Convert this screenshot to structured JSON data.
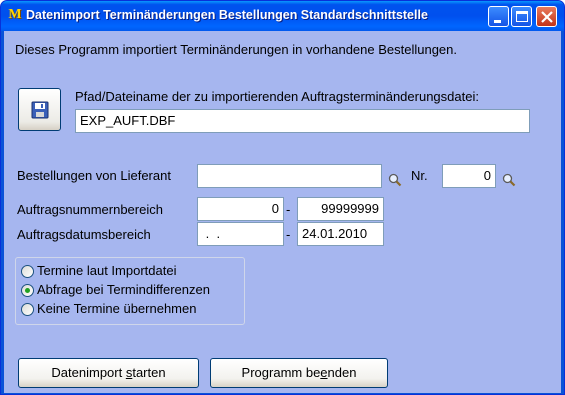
{
  "window": {
    "app_icon": "M",
    "title": "Datenimport Terminänderungen Bestellungen Standardschnittstelle"
  },
  "intro_text": "Dieses Programm importiert Terminänderungen in vorhandene Bestellungen.",
  "file": {
    "label": "Pfad/Dateiname der zu importierenden Auftragsterminänderungsdatei:",
    "value": "EXP_AUFT.DBF",
    "button_icon": "floppy-disk-icon"
  },
  "supplier": {
    "label": "Bestellungen von Lieferant",
    "value": "",
    "nr_label": "Nr.",
    "nr_value": "0",
    "search_icon": "magnifier-icon"
  },
  "order_range": {
    "label": "Auftragsnummernbereich",
    "from": "0",
    "separator": "-",
    "to": "99999999"
  },
  "date_range": {
    "label": "Auftragsdatumsbereich",
    "from": " .  .",
    "separator": "-",
    "to": "24.01.2010"
  },
  "options": [
    {
      "label": "Termine laut Importdatei",
      "selected": false
    },
    {
      "label": "Abfrage bei Termindifferenzen",
      "selected": true
    },
    {
      "label": "Keine Termine übernehmen",
      "selected": false
    }
  ],
  "buttons": {
    "start_pre": "Datenimport ",
    "start_mnemonic": "s",
    "start_post": "tarten",
    "exit_pre": "Programm be",
    "exit_mnemonic": "e",
    "exit_post": "nden"
  },
  "colors": {
    "titlebar": "#0054e3",
    "client_background": "#a6b6ef",
    "radio_selected": "#21a121"
  }
}
